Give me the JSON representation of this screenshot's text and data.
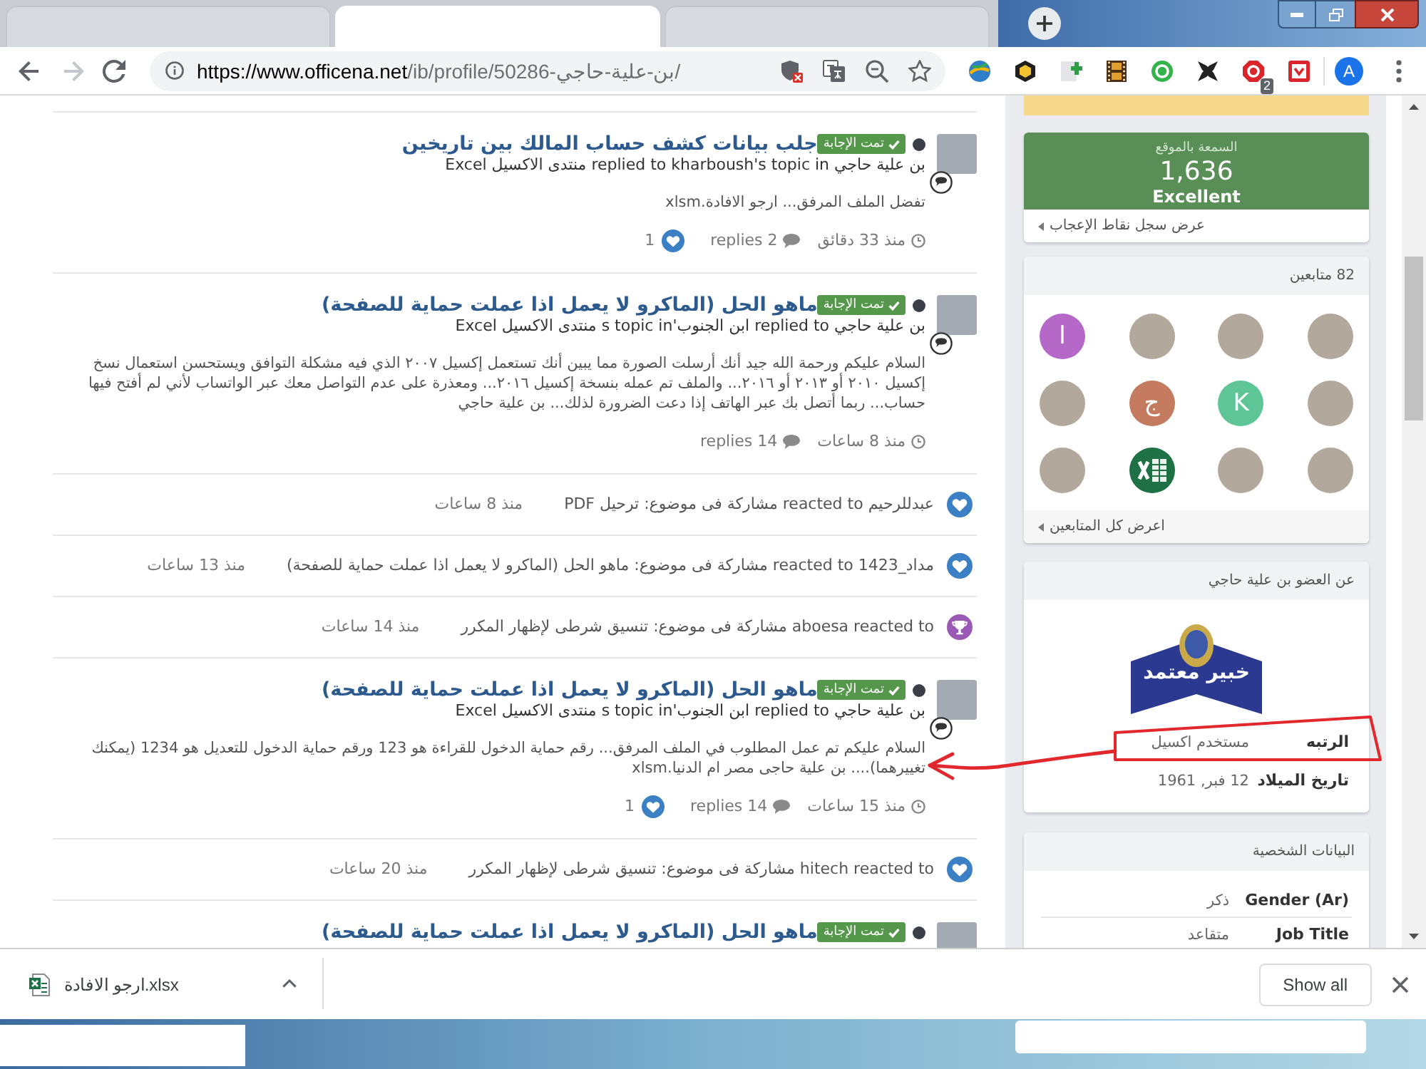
{
  "browser": {
    "tabs": [
      {
        "selected": false
      },
      {
        "selected": true
      },
      {
        "selected": false
      }
    ],
    "forward_disabled": true,
    "url": "https://www.officena.net/ib/profile/50286-بن-علية-حاجي/",
    "extensions": [
      {
        "kind": "globe"
      },
      {
        "kind": "cube"
      },
      {
        "kind": "add"
      },
      {
        "kind": "film"
      },
      {
        "kind": "ring"
      },
      {
        "kind": "cross"
      },
      {
        "kind": "stop",
        "badge": "2"
      },
      {
        "kind": "frame"
      }
    ],
    "profile_initial": "A"
  },
  "feed": [
    {
      "kind": "post",
      "title": "جلب بيانات كشف حساب المالك بين تاريخين",
      "badge": "تمت الإجابة",
      "byline": "بن علية حاجي replied to kharboush's topic in منتدى الاكسيل Excel",
      "excerpt": "تفضل الملف المرفق... ارجو الافادة.xlsm",
      "time": "منذ 33 دقائق",
      "replies": "2 replies",
      "likes": "1"
    },
    {
      "kind": "post",
      "title": "ماهو الحل (الماكرو لا يعمل اذا عملت حماية للصفحة)",
      "badge": "تمت الإجابة",
      "byline": "بن علية حاجي replied to ابن الجنوب's topic in منتدى الاكسيل Excel",
      "excerpt": "السلام عليكم ورحمة الله جيد أنك أرسلت الصورة مما يبين أنك تستعمل إكسيل ٢٠٠٧ الذي فيه مشكلة التوافق ويستحسن استعمال نسخ إكسيل ٢٠١٠ أو ٢٠١٣ أو ٢٠١٦... والملف تم عمله بنسخة إكسيل ٢٠١٦... ومعذرة على عدم التواصل معك عبر الواتساب لأني لم أفتح فيها حساب... ربما أتصل بك عبر الهاتف إذا دعت الضرورة لذلك... بن علية حاجي",
      "time": "منذ 8 ساعات",
      "replies": "14 replies"
    },
    {
      "kind": "like",
      "text": "عبدللرحيم reacted to مشاركة فى موضوع: ترحيل PDF",
      "time": "منذ 8 ساعات"
    },
    {
      "kind": "like",
      "text": "مداد_1423 reacted to مشاركة فى موضوع: ماهو الحل (الماكرو لا يعمل اذا عملت حماية للصفحة)",
      "time": "منذ 13 ساعات"
    },
    {
      "kind": "award",
      "text": "aboesa reacted to مشاركة فى موضوع: تنسيق شرطى لإظهار المكرر",
      "time": "منذ 14 ساعات"
    },
    {
      "kind": "post",
      "title": "ماهو الحل (الماكرو لا يعمل اذا عملت حماية للصفحة)",
      "badge": "تمت الإجابة",
      "byline": "بن علية حاجي replied to ابن الجنوب's topic in منتدى الاكسيل Excel",
      "excerpt": "السلام عليكم تم عمل المطلوب في الملف المرفق... رقم حماية الدخول للقراءة هو 123 ورقم حماية الدخول للتعديل هو 1234 (يمكنك تغييرهما).... بن علية حاجى مصر ام الدنيا.xlsm",
      "time": "منذ 15 ساعات",
      "replies": "14 replies",
      "likes": "1"
    },
    {
      "kind": "like",
      "text": "hitech reacted to مشاركة فى موضوع: تنسيق شرطى لإظهار المكرر",
      "time": "منذ 20 ساعات"
    },
    {
      "kind": "post",
      "title": "ماهو الحل (الماكرو لا يعمل اذا عملت حماية للصفحة)",
      "badge": "تمت الإجابة"
    }
  ],
  "sidebar": {
    "reputation": {
      "label": "السمعة بالموقع",
      "points": "1,636",
      "rating": "Excellent",
      "link": "عرض سجل نقاط الإعجاب"
    },
    "followers": {
      "title": "82 متابعين",
      "people": [
        {
          "kind": "photo"
        },
        {
          "kind": "photo"
        },
        {
          "kind": "photo"
        },
        {
          "kind": "letter",
          "letter": "ا",
          "color": "#b568c7"
        },
        {
          "kind": "photo"
        },
        {
          "kind": "letter",
          "letter": "K",
          "color": "#5ec597"
        },
        {
          "kind": "letter",
          "letter": "ج",
          "color": "#c47b5f"
        },
        {
          "kind": "photo"
        },
        {
          "kind": "photo"
        },
        {
          "kind": "photo"
        },
        {
          "kind": "logo"
        },
        {
          "kind": "photo"
        }
      ],
      "link": "اعرض كل المتابعين"
    },
    "about": {
      "title": "عن العضو بن علية حاجي",
      "badge_text": "خبير معتمد",
      "fields": [
        {
          "label": "الرتبه",
          "value": "مستخدم اكسيل"
        },
        {
          "label": "تاريخ الميلاد",
          "value": "12 فبر, 1961"
        }
      ]
    },
    "personal": {
      "title": "البيانات الشخصية",
      "fields": [
        {
          "label": "Gender (Ar)",
          "value": "ذكر"
        },
        {
          "label": "Job Title",
          "value": "متقاعد"
        }
      ]
    }
  },
  "downloads": {
    "file": "ارجو الافادة.xlsx",
    "show_all": "Show all"
  }
}
